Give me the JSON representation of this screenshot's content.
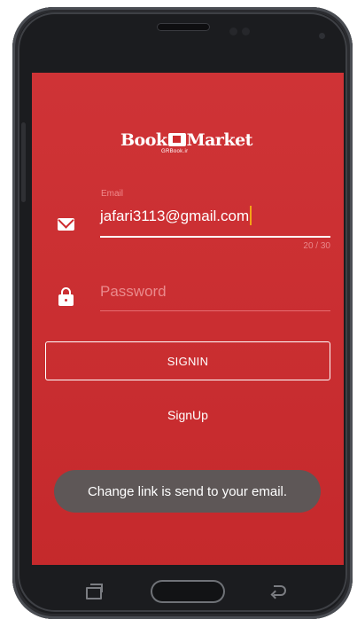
{
  "app": {
    "logo_text": {
      "left": "Book",
      "right": "Market"
    },
    "logo_subtext": "GRBook.ir"
  },
  "login_form": {
    "email_label": "Email",
    "email_value": "jafari3113@gmail.com",
    "email_counter": "20 / 30",
    "password_placeholder": "Password",
    "password_value": "",
    "signin_label": "SIGNIN",
    "signup_label": "SignUp"
  },
  "toast": {
    "message": "Change link is send to your email."
  },
  "icons": {
    "email": "envelope-icon",
    "password": "lock-icon",
    "nav_recent": "recent-apps-icon",
    "nav_home": "home-button",
    "nav_back": "back-icon"
  },
  "colors": {
    "screen_background": "#cd2b2e",
    "cursor": "#f3a316",
    "toast_background": "#5e5757"
  }
}
